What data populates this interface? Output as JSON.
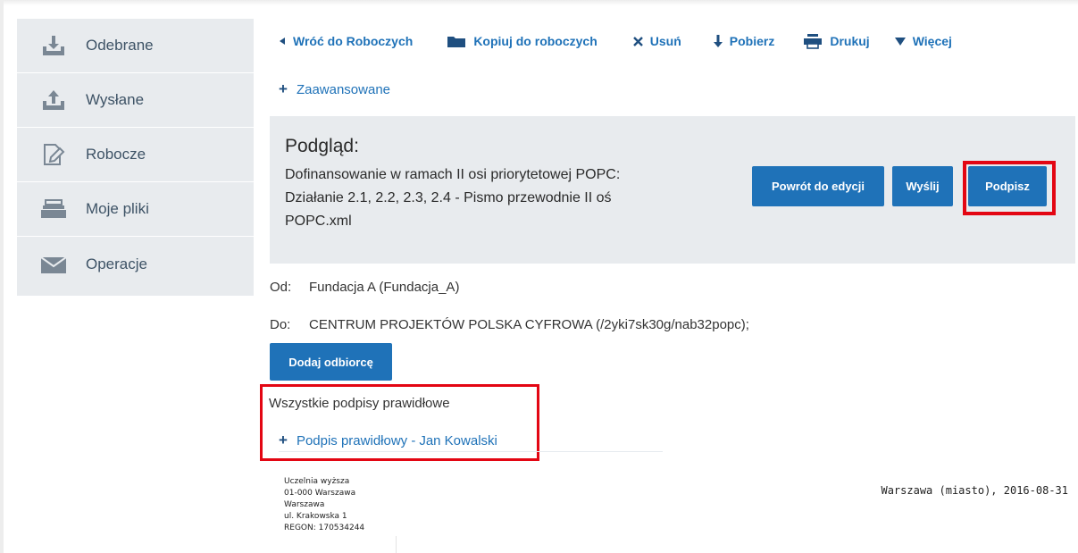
{
  "sidebar": {
    "items": [
      {
        "label": "Odebrane",
        "icon": "download-tray-icon"
      },
      {
        "label": "Wysłane",
        "icon": "upload-tray-icon"
      },
      {
        "label": "Robocze",
        "icon": "draft-edit-icon"
      },
      {
        "label": "Moje pliki",
        "icon": "file-stack-icon"
      },
      {
        "label": "Operacje",
        "icon": "envelope-icon"
      }
    ]
  },
  "toolbar": {
    "back": "Wróć do Roboczych",
    "copy": "Kopiuj do roboczych",
    "delete": "Usuń",
    "download": "Pobierz",
    "print": "Drukuj",
    "more": "Więcej"
  },
  "advanced": {
    "label": "Zaawansowane"
  },
  "preview": {
    "heading": "Podgląd:",
    "document_title": "Dofinansowanie w ramach II osi priorytetowej POPC: Działanie 2.1, 2.2, 2.3, 2.4 - Pismo przewodnie II oś POPC.xml",
    "buttons": {
      "back_to_edit": "Powrót do edycji",
      "send": "Wyślij",
      "sign": "Podpisz"
    }
  },
  "from": {
    "label": "Od:",
    "value": "Fundacja A (Fundacja_A)"
  },
  "to": {
    "label": "Do:",
    "value": "CENTRUM PROJEKTÓW POLSKA CYFROWA (/2yki7sk30g/nab32popc);"
  },
  "add_recipient": "Dodaj odbiorcę",
  "signatures": {
    "summary": "Wszystkie podpisy prawidłowe",
    "entry_status": "Podpis prawidłowy -",
    "entry_name": "Jan Kowalski"
  },
  "document": {
    "sender_lines": [
      "Uczelnia wyższa",
      "01-000 Warszawa",
      "Warszawa",
      "ul. Krakowska 1",
      "REGON: 170534244"
    ],
    "place_date": "Warszawa (miasto), 2016-08-31"
  },
  "colors": {
    "accent": "#1f72b8",
    "highlight": "#e30613",
    "panel": "#e8ebee"
  }
}
